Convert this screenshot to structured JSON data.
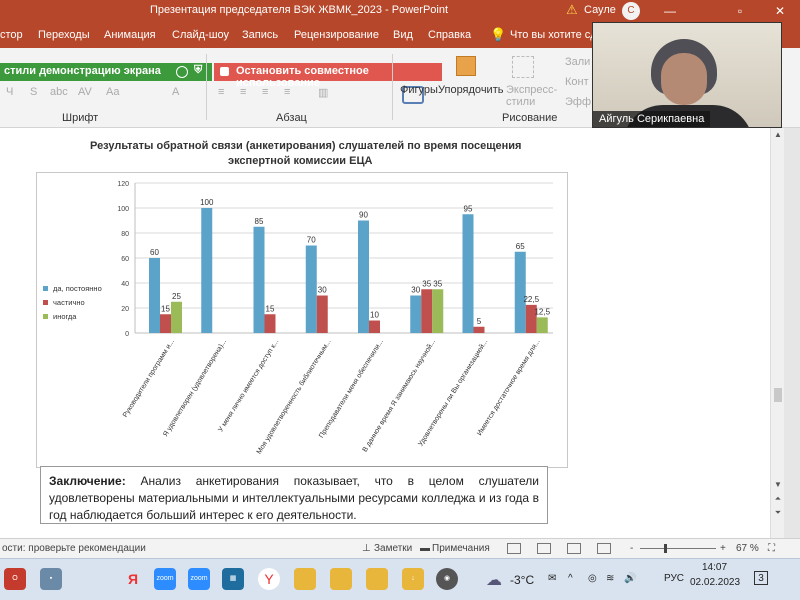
{
  "window": {
    "title": "Презентация председателя ВЭК ЖВМК_2023  -  PowerPoint",
    "user_name": "Сауле",
    "user_initial": "С",
    "controls": [
      "—",
      "▫",
      "✕"
    ]
  },
  "ribbon_tabs": [
    "стор",
    "Переходы",
    "Анимация",
    "Слайд-шоу",
    "Запись",
    "Рецензирование",
    "Вид",
    "Справка",
    "Что вы хотите сде"
  ],
  "ribbon": {
    "screen_share_label": "стили демонстрацию экрана",
    "stop_share_label": "Остановить совместное использование",
    "font_group_label": "Шрифт",
    "paragraph_group_label": "Абзац",
    "drawing_group_label": "Рисование",
    "shapes_label": "Фигуры",
    "arrange_label": "Упорядочить",
    "express_label": "Экспресс-\nстили",
    "right_items": [
      "Зали",
      "Конт",
      "Эфф"
    ]
  },
  "video": {
    "participant_name": "Айгуль Серикпаевна"
  },
  "slide": {
    "title_line1": "Результаты обратной связи (анкетирования) слушателей  по время посещения",
    "title_line2": "экспертной комиссии ЕЦА",
    "conclusion_label": "Заключение:",
    "conclusion_text": "Анализ анкетирования показывает, что в целом слушатели  удовлетворены материальными и интеллектуальными ресурсами колледжа и из года в год наблюдается больший интерес к его деятельности."
  },
  "chart_data": {
    "type": "bar",
    "categories": [
      "Руководители программ и...",
      "Я удовлетворен (удовлетворена)...",
      "У меня лично имеется доступ к...",
      "Моя удовлетворенность библиотечным...",
      "Преподаватели меня обеспечили...",
      "В данное время Я занимаюсь научной...",
      "Удовлетворены ли Вы организацией...",
      "Имеется достаточное время для..."
    ],
    "series": [
      {
        "name": "да, постоянно",
        "color": "#5ba3c9",
        "values": [
          60,
          100,
          85,
          70,
          90,
          30,
          95,
          65
        ]
      },
      {
        "name": "частично",
        "color": "#c0504d",
        "values": [
          15,
          null,
          15,
          30,
          10,
          35,
          5,
          22.5
        ]
      },
      {
        "name": "иногда",
        "color": "#9bbb59",
        "values": [
          25,
          null,
          null,
          null,
          null,
          35,
          null,
          12.5
        ]
      }
    ],
    "data_labels": [
      [
        "60",
        "100",
        "85",
        "70",
        "90",
        "30",
        "95",
        "65"
      ],
      [
        "15",
        "",
        "15",
        "30",
        "10",
        "35",
        "5",
        "22,5"
      ],
      [
        "25",
        "",
        "",
        "",
        "",
        "35",
        "",
        "12,5"
      ]
    ],
    "ylim": [
      0,
      120
    ],
    "yticks": [
      0,
      20,
      40,
      60,
      80,
      100,
      120
    ],
    "legend_position": "left",
    "grid": true
  },
  "statusbar": {
    "accessibility": "ости: проверьте рекомендации",
    "notes_label": "Заметки",
    "comments_label": "Примечания",
    "zoom": "67 %",
    "zoom_minus": "-",
    "zoom_plus": "+"
  },
  "taskbar": {
    "zoom_labels": [
      "zoom",
      "zoom",
      "zoom"
    ],
    "weather": "-3°C",
    "language": "РУС",
    "time": "14:07",
    "date": "02.02.2023",
    "notifications": "3"
  }
}
